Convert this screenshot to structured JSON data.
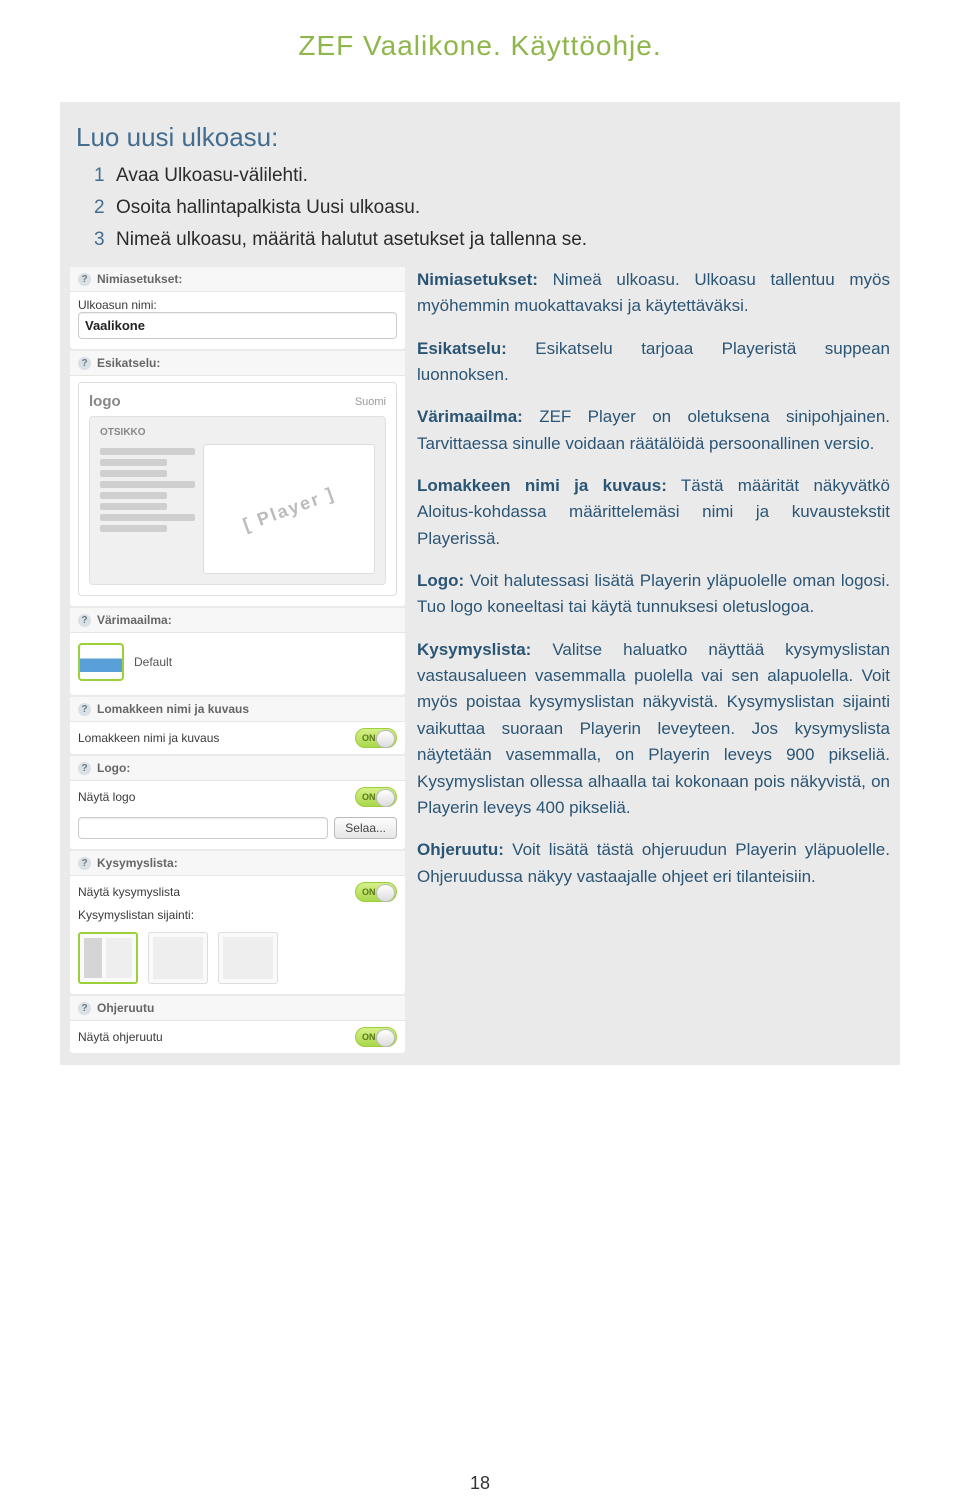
{
  "doc": {
    "title": "ZEF Vaalikone. Käyttöohje.",
    "page_number": "18"
  },
  "section": {
    "heading": "Luo uusi ulkoasu:"
  },
  "steps": [
    {
      "n": "1",
      "text": "Avaa Ulkoasu-välilehti."
    },
    {
      "n": "2",
      "text": "Osoita hallintapalkista Uusi ulkoasu."
    },
    {
      "n": "3",
      "text": "Nimeä ulkoasu, määritä halutut asetukset ja tallenna se."
    }
  ],
  "ui": {
    "nimiasetukset": {
      "title": "Nimiasetukset:",
      "label": "Ulkoasun nimi:",
      "value": "Vaalikone"
    },
    "esikatselu": {
      "title": "Esikatselu:",
      "logo": "logo",
      "lang": "Suomi",
      "heading": "OTSIKKO",
      "stamp": "[ Player ]"
    },
    "varimaailma": {
      "title": "Värimaailma:",
      "option": "Default"
    },
    "lomake": {
      "title": "Lomakkeen nimi ja kuvaus",
      "row_label": "Lomakkeen nimi ja kuvaus",
      "toggle": "ON"
    },
    "logo": {
      "title": "Logo:",
      "row_label": "Näytä logo",
      "toggle": "ON",
      "browse": "Selaa..."
    },
    "kysymyslista": {
      "title": "Kysymyslista:",
      "row_label": "Näytä kysymyslista",
      "toggle": "ON",
      "pos_label": "Kysymyslistan sijainti:"
    },
    "ohjeruutu": {
      "title": "Ohjeruutu",
      "row_label": "Näytä ohjeruutu",
      "toggle": "ON"
    }
  },
  "commentary": {
    "p1_b": "Nimiasetukset:",
    "p1": " Nimeä ulkoasu. Ulkoasu tallentuu myös myöhemmin muokattavaksi ja käytettäväksi.",
    "p2_b": "Esikatselu:",
    "p2": " Esikatselu tarjoaa Playeristä suppean luonnoksen.",
    "p3_b": "Värimaailma:",
    "p3": " ZEF Player on oletuksena sinipohjainen. Tarvittaessa sinulle voidaan räätälöidä persoonallinen versio.",
    "p4_b": "Lomakkeen nimi ja kuvaus:",
    "p4": " Tästä määrität näkyvätkö Aloitus-kohdassa määrittelemäsi nimi ja kuvaustekstit Playerissä.",
    "p5_b": "Logo:",
    "p5": " Voit halutessasi lisätä Playerin yläpuolelle oman logosi. Tuo logo koneeltasi tai käytä tunnuksesi oletuslogoa.",
    "p6_b": "Kysymyslista:",
    "p6": " Valitse haluatko näyttää kysymyslistan vastausalueen vasemmalla puolella vai sen alapuolella. Voit myös poistaa kysymyslistan näkyvistä. Kysymyslistan sijainti vaikuttaa suoraan Playerin leveyteen. Jos kysymyslista näytetään vasemmalla, on Playerin leveys 900 pikseliä. Kysymyslistan ollessa alhaalla tai kokonaan pois näkyvistä, on Playerin leveys 400 pikseliä.",
    "p7_b": "Ohjeruutu:",
    "p7": " Voit lisätä tästä ohjeruudun Playerin yläpuolelle. Ohjeruudussa näkyy vastaajalle ohjeet eri tilanteisiin."
  }
}
